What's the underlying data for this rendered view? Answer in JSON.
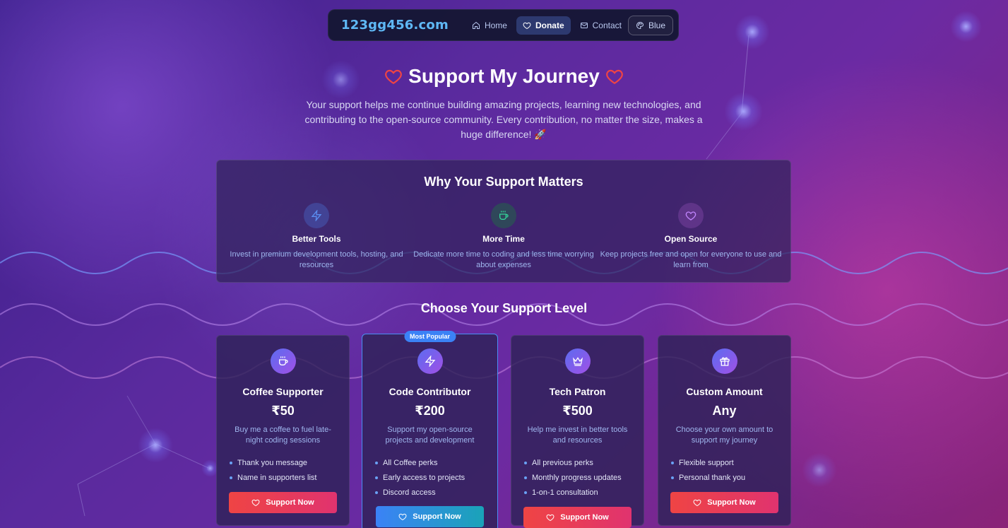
{
  "nav": {
    "brand": "123gg456.com",
    "links": [
      {
        "label": "Home",
        "icon": "home-icon"
      },
      {
        "label": "Donate",
        "icon": "heart-icon",
        "active": true
      },
      {
        "label": "Contact",
        "icon": "mail-icon"
      }
    ],
    "theme_label": "Blue"
  },
  "hero": {
    "title": "Support My Journey",
    "description": "Your support helps me continue building amazing projects, learning new technologies, and contributing to the open-source community. Every contribution, no matter the size, makes a huge difference! 🚀"
  },
  "why": {
    "title": "Why Your Support Matters",
    "items": [
      {
        "name": "Better Tools",
        "desc": "Invest in premium development tools, hosting, and resources",
        "icon": "zap-icon",
        "color": "#5b8df0"
      },
      {
        "name": "More Time",
        "desc": "Dedicate more time to coding and less time worrying about expenses",
        "icon": "coffee-icon",
        "color": "#34d399"
      },
      {
        "name": "Open Source",
        "desc": "Keep projects free and open for everyone to use and learn from",
        "icon": "heart-icon",
        "color": "#c084fc"
      }
    ]
  },
  "levels": {
    "title": "Choose Your Support Level",
    "popular_badge": "Most Popular",
    "button_label": "Support Now",
    "tiers": [
      {
        "name": "Coffee Supporter",
        "price": "₹50",
        "desc": "Buy me a coffee to fuel late-night coding sessions",
        "perks": [
          "Thank you message",
          "Name in supporters list"
        ],
        "icon": "coffee-icon"
      },
      {
        "name": "Code Contributor",
        "price": "₹200",
        "desc": "Support my open-source projects and development",
        "perks": [
          "All Coffee perks",
          "Early access to projects",
          "Discord access"
        ],
        "icon": "zap-icon",
        "popular": true
      },
      {
        "name": "Tech Patron",
        "price": "₹500",
        "desc": "Help me invest in better tools and resources",
        "perks": [
          "All previous perks",
          "Monthly progress updates",
          "1-on-1 consultation"
        ],
        "icon": "crown-icon"
      },
      {
        "name": "Custom Amount",
        "price": "Any",
        "desc": "Choose your own amount to support my journey",
        "perks": [
          "Flexible support",
          "Personal thank you"
        ],
        "icon": "gift-icon"
      }
    ]
  },
  "colors": {
    "accent": "#3b82f6",
    "brand": "#5fb8f5",
    "button_gradient_start": "#ef4444",
    "button_gradient_end": "#e0336f",
    "heart_outline": "#ef4444"
  }
}
